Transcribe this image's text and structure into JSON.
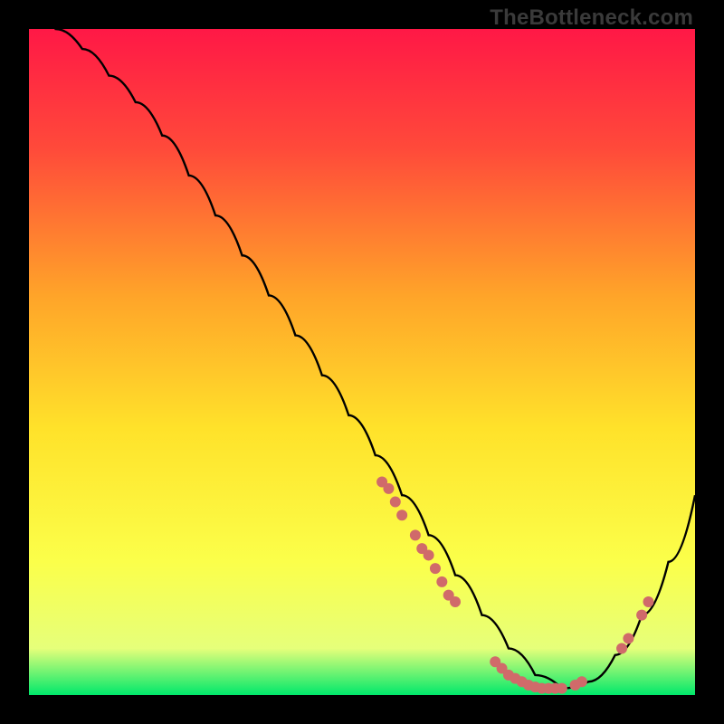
{
  "watermark": "TheBottleneck.com",
  "chart_data": {
    "type": "line",
    "title": "",
    "xlabel": "",
    "ylabel": "",
    "xlim": [
      0,
      100
    ],
    "ylim": [
      0,
      100
    ],
    "gradient_stops": [
      {
        "offset": 0,
        "color": "#ff1846"
      },
      {
        "offset": 18,
        "color": "#ff4a3a"
      },
      {
        "offset": 40,
        "color": "#ffa429"
      },
      {
        "offset": 60,
        "color": "#ffe22a"
      },
      {
        "offset": 80,
        "color": "#fbff4a"
      },
      {
        "offset": 93,
        "color": "#e6ff7a"
      },
      {
        "offset": 100,
        "color": "#00e86b"
      }
    ],
    "series": [
      {
        "name": "curve",
        "x": [
          4,
          8,
          12,
          16,
          20,
          24,
          28,
          32,
          36,
          40,
          44,
          48,
          52,
          56,
          60,
          64,
          68,
          72,
          76,
          80,
          84,
          88,
          92,
          96,
          100
        ],
        "y": [
          100,
          97,
          93,
          89,
          84,
          78,
          72,
          66,
          60,
          54,
          48,
          42,
          36,
          30,
          24,
          18,
          12,
          7,
          3,
          1,
          2,
          6,
          12,
          20,
          30
        ]
      }
    ],
    "points": {
      "name": "markers",
      "color": "#d06a6a",
      "radius": 6,
      "xy": [
        [
          53,
          32
        ],
        [
          54,
          31
        ],
        [
          55,
          29
        ],
        [
          56,
          27
        ],
        [
          58,
          24
        ],
        [
          59,
          22
        ],
        [
          60,
          21
        ],
        [
          61,
          19
        ],
        [
          62,
          17
        ],
        [
          63,
          15
        ],
        [
          64,
          14
        ],
        [
          70,
          5
        ],
        [
          71,
          4
        ],
        [
          72,
          3
        ],
        [
          73,
          2.5
        ],
        [
          74,
          2
        ],
        [
          75,
          1.5
        ],
        [
          76,
          1.2
        ],
        [
          77,
          1
        ],
        [
          78,
          1
        ],
        [
          79,
          1
        ],
        [
          80,
          1
        ],
        [
          82,
          1.5
        ],
        [
          83,
          2
        ],
        [
          89,
          7
        ],
        [
          90,
          8.5
        ],
        [
          92,
          12
        ],
        [
          93,
          14
        ]
      ]
    }
  }
}
